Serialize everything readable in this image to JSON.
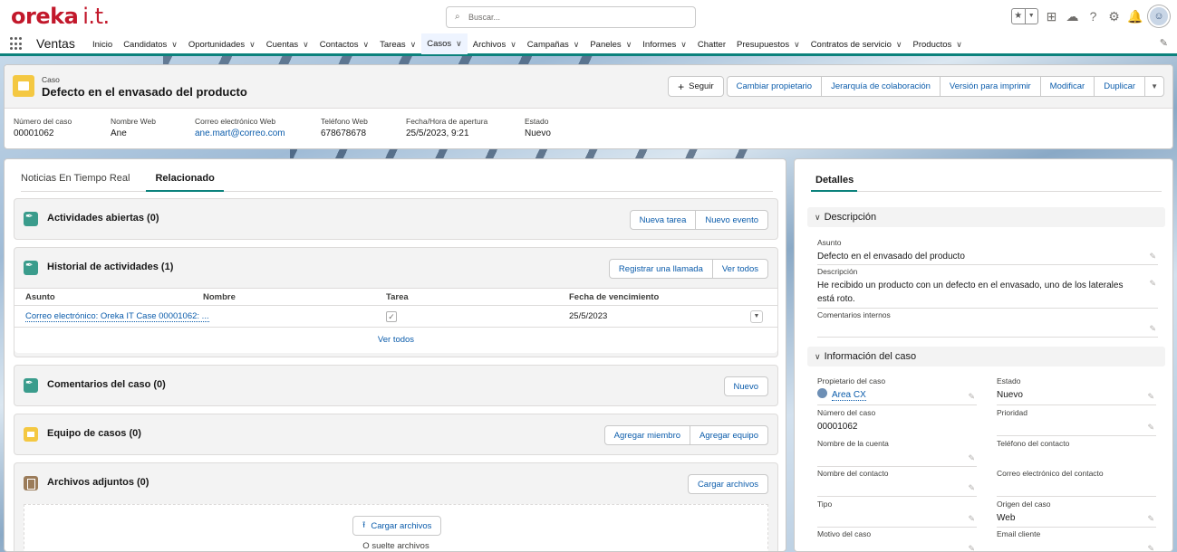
{
  "brand": {
    "name": "oreka",
    "suffix": "i.t.",
    "color": "#c2182b"
  },
  "search": {
    "placeholder": "Buscar..."
  },
  "nav": {
    "app_name": "Ventas",
    "items": [
      {
        "label": "Inicio",
        "has_menu": false
      },
      {
        "label": "Candidatos",
        "has_menu": true
      },
      {
        "label": "Oportunidades",
        "has_menu": true
      },
      {
        "label": "Cuentas",
        "has_menu": true
      },
      {
        "label": "Contactos",
        "has_menu": true
      },
      {
        "label": "Tareas",
        "has_menu": true
      },
      {
        "label": "Casos",
        "has_menu": true,
        "active": true
      },
      {
        "label": "Archivos",
        "has_menu": true
      },
      {
        "label": "Campañas",
        "has_menu": true
      },
      {
        "label": "Paneles",
        "has_menu": true
      },
      {
        "label": "Informes",
        "has_menu": true
      },
      {
        "label": "Chatter",
        "has_menu": false
      },
      {
        "label": "Presupuestos",
        "has_menu": true
      },
      {
        "label": "Contratos de servicio",
        "has_menu": true
      },
      {
        "label": "Productos",
        "has_menu": true
      }
    ]
  },
  "header": {
    "object_label": "Caso",
    "title": "Defecto en el envasado del producto",
    "buttons": {
      "follow": "Seguir",
      "change_owner": "Cambiar propietario",
      "hierarchy": "Jerarquía de colaboración",
      "print": "Versión para imprimir",
      "edit": "Modificar",
      "clone": "Duplicar"
    },
    "fields": [
      {
        "label": "Número del caso",
        "value": "00001062"
      },
      {
        "label": "Nombre Web",
        "value": "Ane"
      },
      {
        "label": "Correo electrónico Web",
        "value": "ane.mart@correo.com",
        "link": true
      },
      {
        "label": "Teléfono Web",
        "value": "678678678"
      },
      {
        "label": "Fecha/Hora de apertura",
        "value": "25/5/2023, 9:21"
      },
      {
        "label": "Estado",
        "value": "Nuevo"
      }
    ]
  },
  "left": {
    "tabs": [
      "Noticias En Tiempo Real",
      "Relacionado"
    ],
    "open_activities": {
      "title": "Actividades abiertas (0)",
      "btn1": "Nueva tarea",
      "btn2": "Nuevo evento"
    },
    "activity_history": {
      "title": "Historial de actividades (1)",
      "btn1": "Registrar una llamada",
      "btn2": "Ver todos",
      "columns": [
        "Asunto",
        "Nombre",
        "Tarea",
        "Fecha de vencimiento"
      ],
      "rows": [
        {
          "subject": "Correo electrónico: Oreka IT Case 00001062: ...",
          "name": "",
          "task": true,
          "due": "25/5/2023"
        }
      ],
      "view_all": "Ver todos"
    },
    "case_comments": {
      "title": "Comentarios del caso (0)",
      "btn1": "Nuevo"
    },
    "case_team": {
      "title": "Equipo de casos (0)",
      "btn1": "Agregar miembro",
      "btn2": "Agregar equipo"
    },
    "attachments": {
      "title": "Archivos adjuntos (0)",
      "btn1": "Cargar archivos",
      "upload_btn": "Cargar archivos",
      "drop_text": "O suelte archivos"
    }
  },
  "right": {
    "tab": "Detalles",
    "section_desc": "Descripción",
    "subject": {
      "label": "Asunto",
      "value": "Defecto en el envasado del producto"
    },
    "description": {
      "label": "Descripción",
      "value": "He recibido un producto con un defecto en el envasado, uno de los laterales está roto."
    },
    "internal_comments": {
      "label": "Comentarios internos",
      "value": ""
    },
    "section_info": "Información del caso",
    "owner": {
      "label": "Propietario del caso",
      "value": "Area CX"
    },
    "status": {
      "label": "Estado",
      "value": "Nuevo"
    },
    "case_number": {
      "label": "Número del caso",
      "value": "00001062"
    },
    "priority": {
      "label": "Prioridad",
      "value": ""
    },
    "account_name": {
      "label": "Nombre de la cuenta",
      "value": ""
    },
    "contact_phone": {
      "label": "Teléfono del contacto",
      "value": ""
    },
    "contact_name": {
      "label": "Nombre del contacto",
      "value": ""
    },
    "contact_email": {
      "label": "Correo electrónico del contacto",
      "value": ""
    },
    "type": {
      "label": "Tipo",
      "value": ""
    },
    "origin": {
      "label": "Origen del caso",
      "value": "Web"
    },
    "reason": {
      "label": "Motivo del caso",
      "value": ""
    },
    "client_email": {
      "label": "Email cliente",
      "value": ""
    }
  },
  "colors": {
    "accent": "#0b827c",
    "link": "#0b5cab",
    "case_icon": "#f4c842",
    "activity_icon": "#3a9c8c"
  }
}
